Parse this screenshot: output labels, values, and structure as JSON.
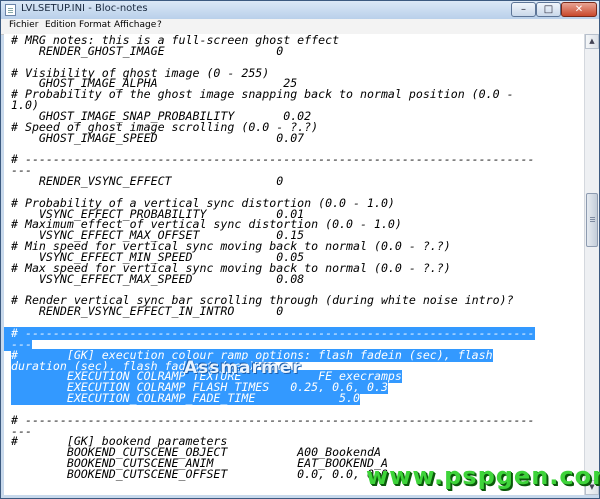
{
  "window": {
    "title": "LVLSETUP.INI - Bloc-notes",
    "minimize": "–",
    "maximize": "□",
    "close": "✕",
    "app_icon": "notepad-icon"
  },
  "menu": [
    "Fichier",
    "Edition",
    "Format",
    "Affichage",
    "?"
  ],
  "editor_lines": [
    "# MRG notes: this is a full-screen ghost effect",
    "    RENDER_GHOST_IMAGE                0",
    "",
    "# Visibility of ghost image (0 - 255)",
    "    GHOST_IMAGE_ALPHA                  25",
    "# Probability of the ghost image snapping back to normal position (0.0 -",
    "1.0)",
    "    GHOST_IMAGE_SNAP_PROBABILITY       0.02",
    "# Speed of ghost image scrolling (0.0 - ?.?)",
    "    GHOST_IMAGE_SPEED                 0.07",
    "",
    "# -------------------------------------------------------------------------",
    "---",
    "    RENDER_VSYNC_EFFECT               0",
    "",
    "# Probability of a vertical sync distortion (0.0 - 1.0)",
    "    VSYNC_EFFECT_PROBABILITY          0.01",
    "# Maximum effect of vertical sync distortion (0.0 - 1.0)",
    "    VSYNC_EFFECT_MAX_OFFSET           0.15",
    "# Min speed for vertical sync moving back to normal (0.0 - ?.?)",
    "    VSYNC_EFFECT_MIN_SPEED            0.05",
    "# Max speed for vertical sync moving back to normal (0.0 - ?.?)",
    "    VSYNC_EFFECT_MAX_SPEED            0.08",
    "",
    "# Render vertical sync bar scrolling through (during white noise intro)?",
    "    RENDER_VSYNC_EFFECT_IN_INTRO      0",
    "",
    "# -------------------------------------------------------------------------",
    "---",
    "#       [GK] execution colour ramp options: flash fadein (sec), flash",
    "duration (sec), flash fadeout (sec)",
    "        EXECUTION_COLRAMP_TEXTURE           FE_execramps",
    "        EXECUTION_COLRAMP_FLASH_TIMES   0.25, 0.6, 0.3",
    "        EXECUTION_COLRAMP_FADE_TIME            5.0",
    "",
    "# -------------------------------------------------------------------------",
    "---",
    "#       [GK] bookend parameters",
    "        BOOKEND_CUTSCENE_OBJECT          A00_BookendA",
    "        BOOKEND_CUTSCENE_ANIM            EAT_BOOKEND_A",
    "        BOOKEND_CUTSCENE_OFFSET          0.0, 0.0, 0.0"
  ],
  "selected_lines": [
    27,
    28,
    29,
    30,
    31,
    32,
    33
  ],
  "watermarks": [
    "Assmarmer",
    "www.pspgen.com"
  ],
  "colors": {
    "selection": "#3399ff",
    "title_bar": "#c8d9ec",
    "close_button": "#c9482c"
  }
}
